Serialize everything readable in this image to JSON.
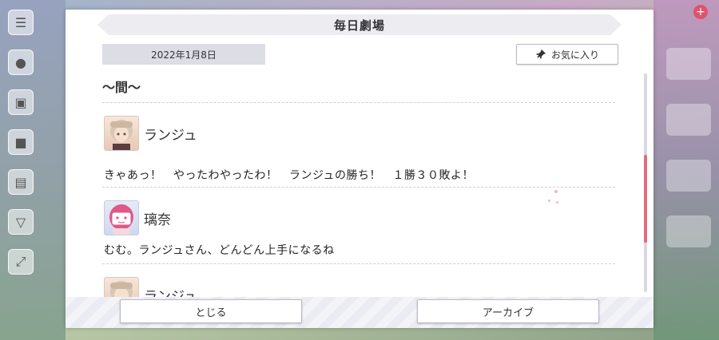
{
  "dialog": {
    "title": "毎日劇場",
    "date": "2022年1月8日",
    "favorite_label": "お気に入り",
    "scene_title": "〜間〜"
  },
  "script": {
    "entries": [
      {
        "speaker": "ランジュ",
        "line": "きゃあっ！　やったわやったわ！　ランジュの勝ち！　１勝３０敗よ！"
      },
      {
        "speaker": "璃奈",
        "line": "むむ。ランジュさん、どんどん上手になるね"
      },
      {
        "speaker": "ランジュ",
        "line": ""
      }
    ]
  },
  "footer": {
    "close_label": "とじる",
    "archive_label": "アーカイブ"
  },
  "icons": {
    "favorite": "pin-icon",
    "menu": "hamburger-icon"
  },
  "colors": {
    "accent": "#e46b7c",
    "title_bg": "#ececf1",
    "date_bg": "#dddde6"
  }
}
